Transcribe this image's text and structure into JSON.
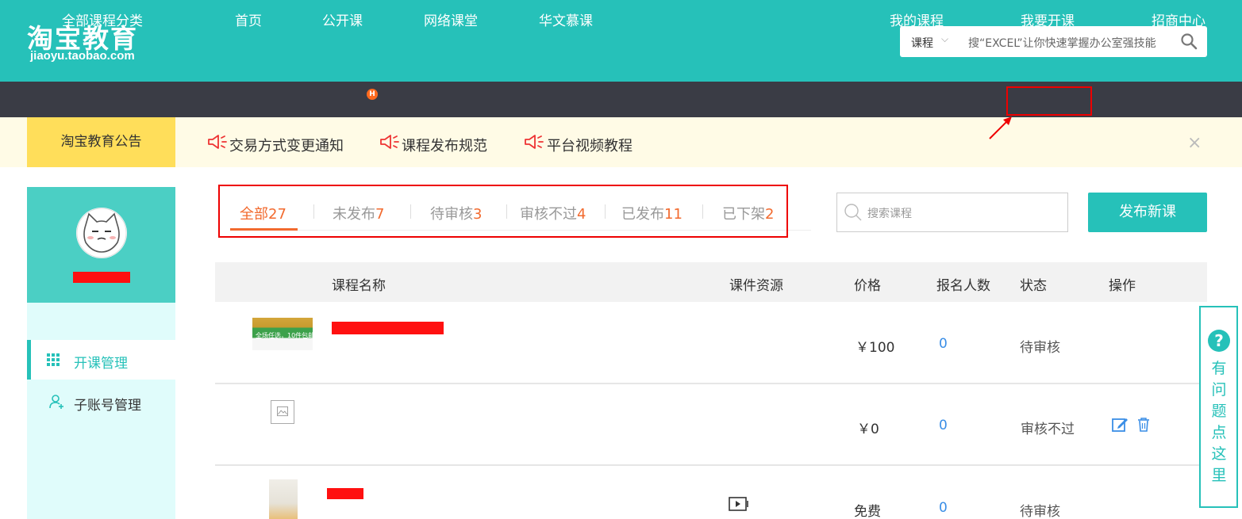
{
  "header": {
    "logo_title": "淘宝教育",
    "logo_domain": "jiaoyu.taobao.com",
    "search": {
      "category": "课程",
      "placeholder": "搜“EXCEL”让你快速掌握办公室强技能",
      "icon": "search-icon"
    }
  },
  "nav": {
    "items": [
      "全部课程分类",
      "首页",
      "公开课",
      "网络课堂",
      "华文慕课",
      "我的课程",
      "我要开课",
      "招商中心"
    ],
    "hot_badge": "H"
  },
  "notice": {
    "title": "淘宝教育公告",
    "items": [
      "交易方式变更通知",
      "课程发布规范",
      "平台视频教程"
    ],
    "close": "×"
  },
  "sidebar": {
    "items": [
      {
        "label": "开课管理",
        "icon": "grid-icon",
        "active": true
      },
      {
        "label": "子账号管理",
        "icon": "user-add-icon",
        "active": false
      }
    ]
  },
  "tabs": [
    {
      "label": "全部",
      "count": "27",
      "active": true
    },
    {
      "label": "未发布",
      "count": "7"
    },
    {
      "label": "待审核",
      "count": "3"
    },
    {
      "label": "审核不过",
      "count": "4"
    },
    {
      "label": "已发布",
      "count": "11"
    },
    {
      "label": "已下架",
      "count": "2"
    }
  ],
  "course_search": {
    "placeholder": "搜索课程"
  },
  "publish_button": "发布新课",
  "table": {
    "headers": [
      "课程名称",
      "课件资源",
      "价格",
      "报名人数",
      "状态",
      "操作"
    ],
    "rows": [
      {
        "thumb_text": "全场任选，10件包邮",
        "price": "￥100",
        "enrolled": "0",
        "status": "待审核"
      },
      {
        "price": "￥0",
        "enrolled": "0",
        "status": "审核不过"
      },
      {
        "price": "免费",
        "enrolled": "0",
        "status": "待审核"
      }
    ]
  },
  "help": {
    "icon": "?",
    "text": "有问题点这里"
  },
  "colors": {
    "brand": "#26c1b9",
    "nav_bg": "#3a3c45",
    "accent": "#f26a2e",
    "notice_bg": "#fffbe6",
    "notice_title_bg": "#ffde5a",
    "highlight_red": "#ee0000"
  }
}
